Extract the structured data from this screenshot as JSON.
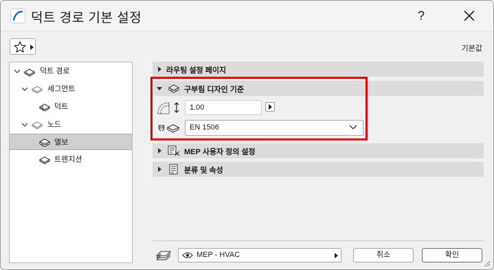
{
  "window": {
    "title": "덕트 경로 기본 설정",
    "help_label": "?",
    "default_label": "기본값"
  },
  "tree": {
    "items": [
      {
        "label": "덕트 경로",
        "expanded": true,
        "selected": false
      },
      {
        "label": "세그먼트",
        "expanded": true,
        "selected": false
      },
      {
        "label": "덕트",
        "selected": false
      },
      {
        "label": "노드",
        "expanded": true,
        "selected": false
      },
      {
        "label": "엘보",
        "selected": true
      },
      {
        "label": "트렌지션",
        "selected": false
      }
    ]
  },
  "sections": [
    {
      "label": "라우팅 설정 페이지",
      "expanded": false
    },
    {
      "label": "구부림 디자인 기준",
      "expanded": true
    },
    {
      "label": "MEP 사용자 정의 설정",
      "expanded": false
    },
    {
      "label": "분류 및 속성",
      "expanded": false
    }
  ],
  "bend": {
    "radius_value": "1.00",
    "standard_value": "EN 1506"
  },
  "footer": {
    "view_label": "MEP - HVAC",
    "cancel_label": "취소",
    "ok_label": "확인"
  },
  "colors": {
    "highlight": "#e00000",
    "selected_row": "#cfcfcf",
    "section_bg": "#dcdcdc",
    "logo": "#1a6fc9"
  }
}
